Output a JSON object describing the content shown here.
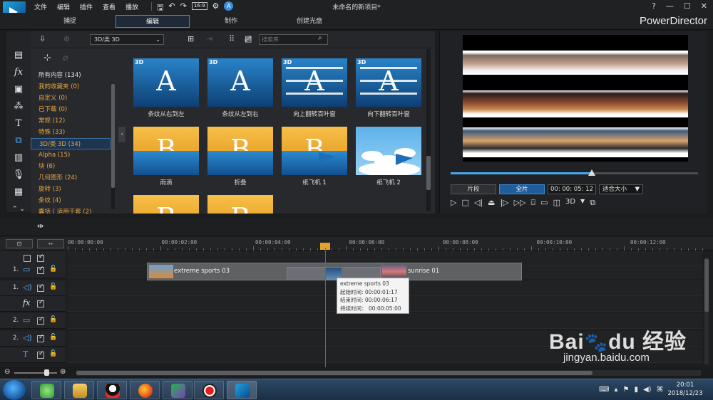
{
  "menu": [
    "文件",
    "编辑",
    "插件",
    "查看",
    "播放"
  ],
  "toolbar": {
    "ratio": "16:9",
    "badge_icon": "a-letter-icon"
  },
  "project_title": "未命名的新项目*",
  "window_controls": [
    "?",
    "—",
    "☐",
    "✕"
  ],
  "modes": [
    {
      "label": "捕捉",
      "active": false
    },
    {
      "label": "编辑",
      "active": true
    },
    {
      "label": "制作",
      "active": false
    },
    {
      "label": "创建光盘",
      "active": false
    }
  ],
  "brand": "PowerDirector",
  "library": {
    "category_select": "3D/类 3D",
    "search_placeholder": "搜索库",
    "categories": [
      {
        "label": "所有内容 (134)",
        "color": "white"
      },
      {
        "label": "我的收藏夹 (0)",
        "color": "orange"
      },
      {
        "label": "自定义 (0)",
        "color": "orange"
      },
      {
        "label": "已下载 (0)",
        "color": "orange"
      },
      {
        "label": "常规 (12)",
        "color": "orange"
      },
      {
        "label": "特殊 (33)",
        "color": "orange"
      },
      {
        "label": "3D/类 3D (34)",
        "color": "orange",
        "selected": true
      },
      {
        "label": "Alpha (15)",
        "color": "orange"
      },
      {
        "label": "块 (6)",
        "color": "orange"
      },
      {
        "label": "几何图形 (24)",
        "color": "orange"
      },
      {
        "label": "旋转 (3)",
        "color": "orange"
      },
      {
        "label": "条纹 (4)",
        "color": "orange"
      },
      {
        "label": "囊括 ( 适用于套 (2)",
        "color": "orange"
      }
    ],
    "tiles": [
      {
        "label": "条纹从右到左",
        "badge": "3D",
        "style": "blue"
      },
      {
        "label": "条纹从左到右",
        "badge": "3D",
        "style": "blue"
      },
      {
        "label": "向上翻转百叶窗",
        "badge": "3D",
        "style": "blue-stripes"
      },
      {
        "label": "向下翻转百叶窗",
        "badge": "3D",
        "style": "blue-stripes"
      },
      {
        "label": "雨滴",
        "badge": "",
        "style": "orange"
      },
      {
        "label": "折叠",
        "badge": "",
        "style": "orange"
      },
      {
        "label": "纸飞机 1",
        "badge": "",
        "style": "orange"
      },
      {
        "label": "纸飞机 2",
        "badge": "",
        "style": "sky"
      },
      {
        "label": "",
        "badge": "",
        "style": "orange"
      },
      {
        "label": "",
        "badge": "",
        "style": "orange"
      }
    ]
  },
  "preview": {
    "clip_button": "片段",
    "movie_button": "全片",
    "timecode": "00: 00: 05: 12",
    "fit": "适合大小",
    "mode_3d": "3D",
    "scrub_position": 0.57
  },
  "timeline": {
    "ruler_labels": [
      "00:00:00:00",
      "00:00:02:00",
      "00:00:04:00",
      "00:00:06:00",
      "00:00:08:00",
      "00:00:10:00",
      "00:00:12:00"
    ],
    "tracks": [
      {
        "num": "",
        "type": "all"
      },
      {
        "num": "1.",
        "type": "video"
      },
      {
        "num": "1.",
        "type": "audio"
      },
      {
        "num": "",
        "type": "fx"
      },
      {
        "num": "2.",
        "type": "video"
      },
      {
        "num": "2.",
        "type": "audio"
      },
      {
        "num": "",
        "type": "title"
      }
    ],
    "clips": [
      {
        "label": "extreme sports 03"
      },
      {
        "label": "sunrise 01"
      }
    ],
    "tooltip": {
      "title": "extreme sports 03",
      "start": "起始时间: 00:00:01:17",
      "end": "结束时间: 00:00:06:17",
      "duration": "持续时间： 00:00:05:00"
    }
  },
  "taskbar": {
    "time": "20:01",
    "date": "2018/12/23"
  },
  "watermark": {
    "brand": "Bai",
    "brand2": "du 经验",
    "url": "jingyan.baidu.com"
  }
}
